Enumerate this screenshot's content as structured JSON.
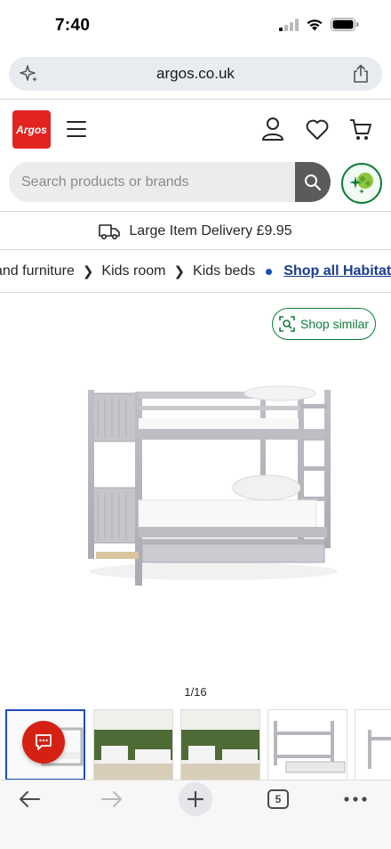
{
  "status_bar": {
    "time": "7:40"
  },
  "browser": {
    "url": "argos.co.uk",
    "tab_count": "5"
  },
  "header": {
    "logo_text": "Argos"
  },
  "search": {
    "placeholder": "Search products or brands"
  },
  "delivery_banner": {
    "text": "Large Item Delivery £9.95"
  },
  "breadcrumb": {
    "items": [
      "and furniture",
      "Kids room",
      "Kids beds"
    ],
    "link": "Shop all Habitat"
  },
  "product": {
    "shop_similar_label": "Shop similar",
    "image_counter": "1/16"
  },
  "colors": {
    "brand_red": "#e1241f",
    "accent_green": "#0f7b38",
    "link_blue": "#1a3b8f"
  },
  "icons": [
    "sparkle-icon",
    "share-icon",
    "menu-icon",
    "account-icon",
    "heart-icon",
    "basket-icon",
    "search-icon",
    "delivery-truck-icon",
    "chat-icon",
    "back-arrow-icon",
    "forward-arrow-icon",
    "plus-icon",
    "tabs-icon",
    "more-icon"
  ]
}
